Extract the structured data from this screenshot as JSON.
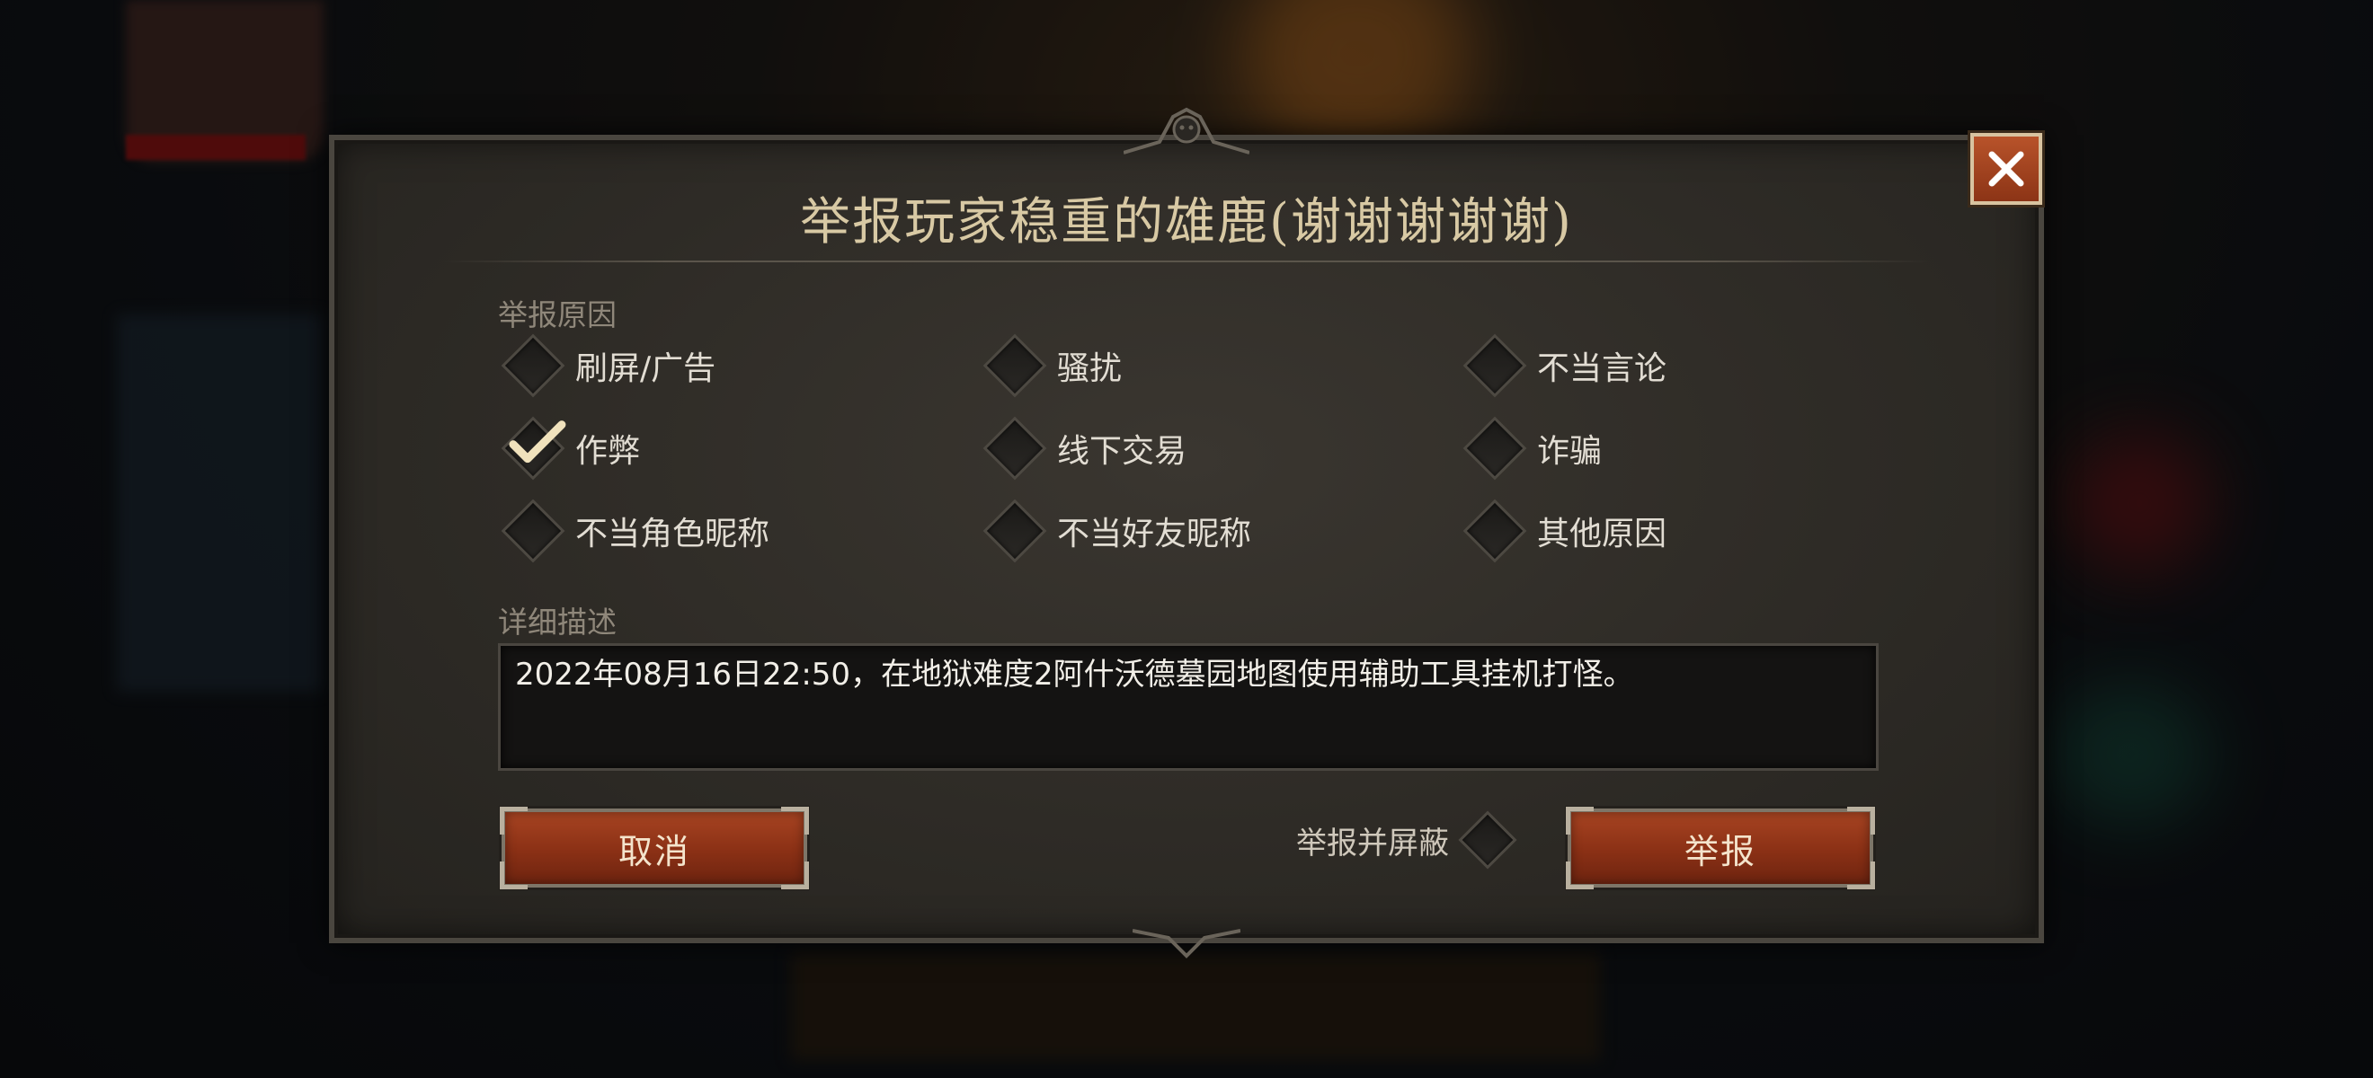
{
  "dialog": {
    "title": "举报玩家稳重的雄鹿(谢谢谢谢谢)",
    "close_icon": "close-icon"
  },
  "reasons": {
    "label": "举报原因",
    "options": [
      {
        "label": "刷屏/广告",
        "checked": false
      },
      {
        "label": "骚扰",
        "checked": false
      },
      {
        "label": "不当言论",
        "checked": false
      },
      {
        "label": "作弊",
        "checked": true
      },
      {
        "label": "线下交易",
        "checked": false
      },
      {
        "label": "诈骗",
        "checked": false
      },
      {
        "label": "不当角色昵称",
        "checked": false
      },
      {
        "label": "不当好友昵称",
        "checked": false
      },
      {
        "label": "其他原因",
        "checked": false
      }
    ]
  },
  "description": {
    "label": "详细描述",
    "value": "2022年08月16日22:50，在地狱难度2阿什沃德墓园地图使用辅助工具挂机打怪。"
  },
  "actions": {
    "cancel_label": "取消",
    "report_and_block_label": "举报并屏蔽",
    "report_and_block_checked": false,
    "report_label": "举报"
  },
  "colors": {
    "accent_button": "#8a3015",
    "title_text": "#d8c9a4",
    "check": "#f0e2bc"
  }
}
